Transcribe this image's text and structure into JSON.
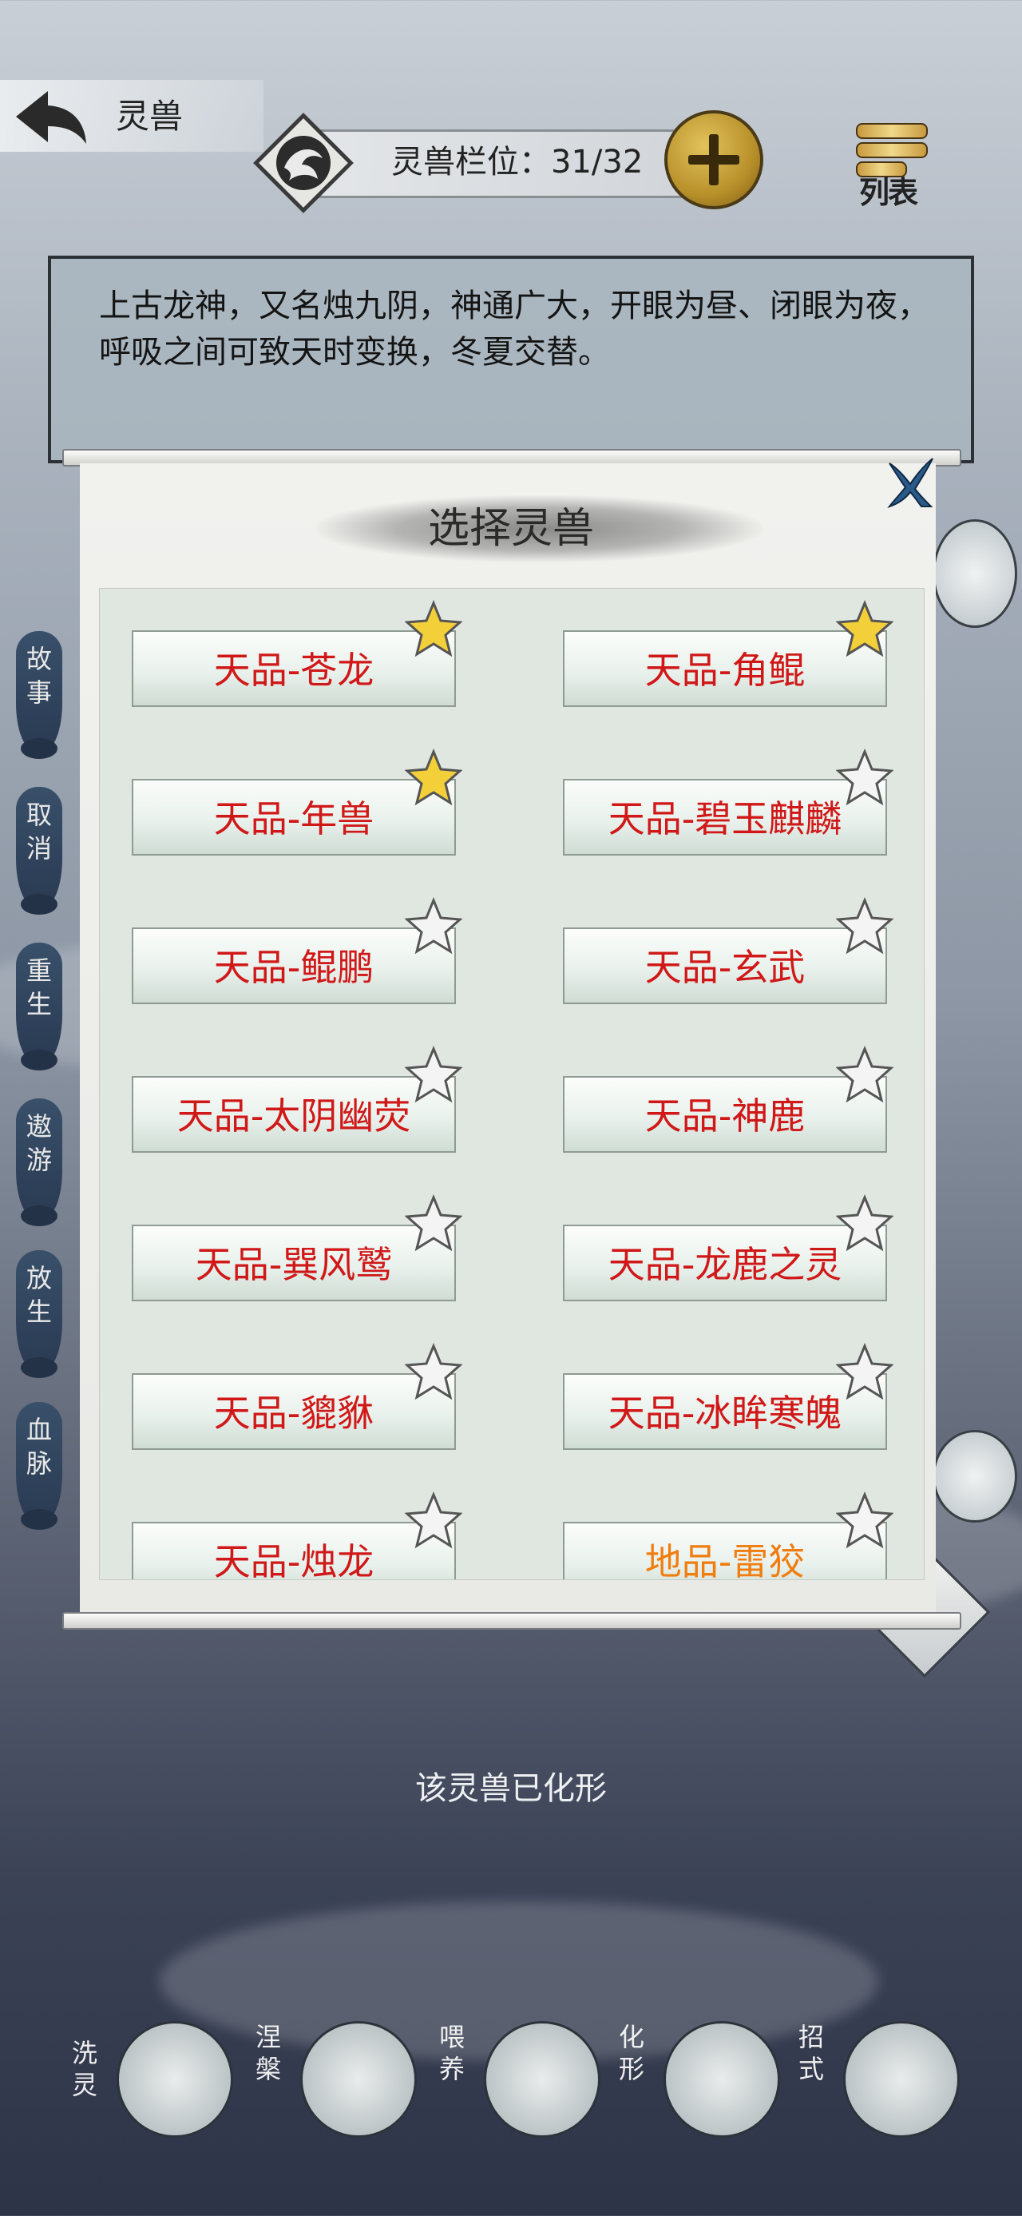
{
  "header": {
    "back_label": "",
    "title": "灵兽",
    "slot_label": "灵兽栏位：31/32",
    "add_label": "",
    "list_label": "列表"
  },
  "description": "上古龙神，又名烛九阴，神通广大，开眼为昼、闭眼为夜，呼吸之间可致天时变换，冬夏交替。",
  "side_menu": [
    "故事",
    "取消",
    "重生",
    "遨游",
    "放生",
    "血脉"
  ],
  "dialog": {
    "title": "选择灵兽",
    "beasts": [
      {
        "label": "天品-苍龙",
        "starred": true,
        "color": "#d01818"
      },
      {
        "label": "天品-角鲲",
        "starred": true,
        "color": "#d01818"
      },
      {
        "label": "天品-年兽",
        "starred": true,
        "color": "#d01818"
      },
      {
        "label": "天品-碧玉麒麟",
        "starred": false,
        "color": "#d01818"
      },
      {
        "label": "天品-鲲鹏",
        "starred": false,
        "color": "#d01818"
      },
      {
        "label": "天品-玄武",
        "starred": false,
        "color": "#d01818"
      },
      {
        "label": "天品-太阴幽荧",
        "starred": false,
        "color": "#d01818"
      },
      {
        "label": "天品-神鹿",
        "starred": false,
        "color": "#d01818"
      },
      {
        "label": "天品-巽风鹫",
        "starred": false,
        "color": "#d01818"
      },
      {
        "label": "天品-龙鹿之灵",
        "starred": false,
        "color": "#d01818"
      },
      {
        "label": "天品-貔貅",
        "starred": false,
        "color": "#d01818"
      },
      {
        "label": "天品-冰眸寒魄",
        "starred": false,
        "color": "#d01818"
      },
      {
        "label": "天品-烛龙",
        "starred": false,
        "color": "#d01818"
      },
      {
        "label": "地品-雷狡",
        "starred": false,
        "color": "#f07d10"
      }
    ]
  },
  "status_text": "该灵兽已化形",
  "bottom_actions": [
    {
      "label": "洗灵",
      "icon": "cauldron-icon"
    },
    {
      "label": "涅槃",
      "icon": "phoenix-swirl-icon"
    },
    {
      "label": "喂养",
      "icon": "meat-icon"
    },
    {
      "label": "化形",
      "icon": "dragon-figure-icon"
    },
    {
      "label": "招式",
      "icon": "scroll-icon"
    }
  ]
}
